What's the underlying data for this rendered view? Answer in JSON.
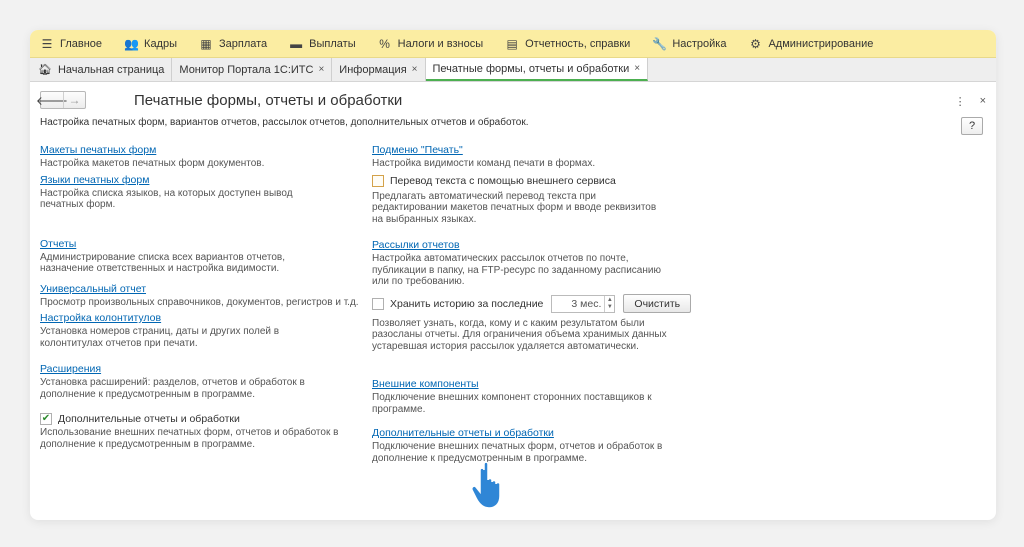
{
  "menu": [
    {
      "label": "Главное",
      "icon": "hamburger-icon",
      "glyph": "☰"
    },
    {
      "label": "Кадры",
      "icon": "people-icon",
      "glyph": "👥"
    },
    {
      "label": "Зарплата",
      "icon": "calculator-icon",
      "glyph": "▦"
    },
    {
      "label": "Выплаты",
      "icon": "wallet-icon",
      "glyph": "▬"
    },
    {
      "label": "Налоги и взносы",
      "icon": "percent-icon",
      "glyph": "%"
    },
    {
      "label": "Отчетность, справки",
      "icon": "documents-icon",
      "glyph": "▤"
    },
    {
      "label": "Настройка",
      "icon": "wrench-icon",
      "glyph": "🔧"
    },
    {
      "label": "Администрирование",
      "icon": "gear-icon",
      "glyph": "⚙"
    }
  ],
  "tabs": [
    {
      "label": "Начальная страница",
      "closable": false
    },
    {
      "label": "Монитор Портала 1С:ИТС",
      "closable": true
    },
    {
      "label": "Информация",
      "closable": true
    },
    {
      "label": "Печатные формы, отчеты и обработки",
      "closable": true,
      "active": true
    }
  ],
  "tab_close_glyph": "×",
  "page": {
    "title": "Печатные формы, отчеты и обработки",
    "subtitle": "Настройка печатных форм, вариантов отчетов, рассылок отчетов, дополнительных отчетов и обработок.",
    "back_glyph": "🡐",
    "forward_glyph": "→",
    "more_glyph": "⋮",
    "close_glyph": "×",
    "help_label": "?"
  },
  "left": {
    "print_layouts": {
      "link": "Макеты печатных форм",
      "desc": "Настройка макетов печатных форм документов."
    },
    "print_languages": {
      "link": "Языки печатных форм",
      "desc": "Настройка списка языков, на которых доступен вывод печатных форм."
    },
    "reports": {
      "link": "Отчеты",
      "desc": "Администрирование списка всех вариантов отчетов, назначение ответственных и настройка видимости."
    },
    "universal_report": {
      "link": "Универсальный отчет",
      "desc": "Просмотр произвольных справочников, документов, регистров и т.д."
    },
    "headers_footers": {
      "link": "Настройка колонтитулов",
      "desc": "Установка номеров страниц, даты и других полей в колонтитулах отчетов при печати."
    },
    "extensions": {
      "link": "Расширения",
      "desc": "Установка расширений: разделов, отчетов и обработок в дополнение к предусмотренным в программе."
    },
    "additional_reports": {
      "check_label": "Дополнительные отчеты и обработки",
      "checked": true,
      "check_glyph": "✔",
      "desc": "Использование внешних печатных форм, отчетов и обработок в дополнение к предусмотренным в программе."
    }
  },
  "right": {
    "print_submenu": {
      "link": "Подменю \"Печать\"",
      "desc": "Настройка видимости команд печати в формах."
    },
    "translation": {
      "check_label": "Перевод текста с помощью внешнего сервиса",
      "checked": false,
      "desc": "Предлагать автоматический перевод текста при редактировании макетов печатных форм и вводе реквизитов на выбранных языках."
    },
    "mailings": {
      "link": "Рассылки отчетов",
      "desc": "Настройка автоматических рассылок отчетов по почте, публикации в папку, на FTP-ресурс по заданному расписанию или по требованию."
    },
    "history": {
      "check_label": "Хранить историю за последние",
      "checked": false,
      "value": "3 мес.",
      "spin_up": "▲",
      "spin_down": "▼",
      "clear_label": "Очистить",
      "desc": "Позволяет узнать, когда, кому и с каким результатом были разосланы отчеты. Для ограничения объема хранимых данных устаревшая история рассылок удаляется автоматически."
    },
    "external_components": {
      "link": "Внешние компоненты",
      "desc": "Подключение внешних компонент сторонних поставщиков к программе."
    },
    "additional_reports": {
      "link": "Дополнительные отчеты и обработки",
      "desc": "Подключение внешних печатных форм, отчетов и обработок в дополнение к предусмотренным в программе."
    }
  },
  "colors": {
    "menubar": "#fbeda2",
    "link": "#0066b3",
    "active_tab_underline": "#4caf50",
    "cursor": "#2f86d6"
  }
}
